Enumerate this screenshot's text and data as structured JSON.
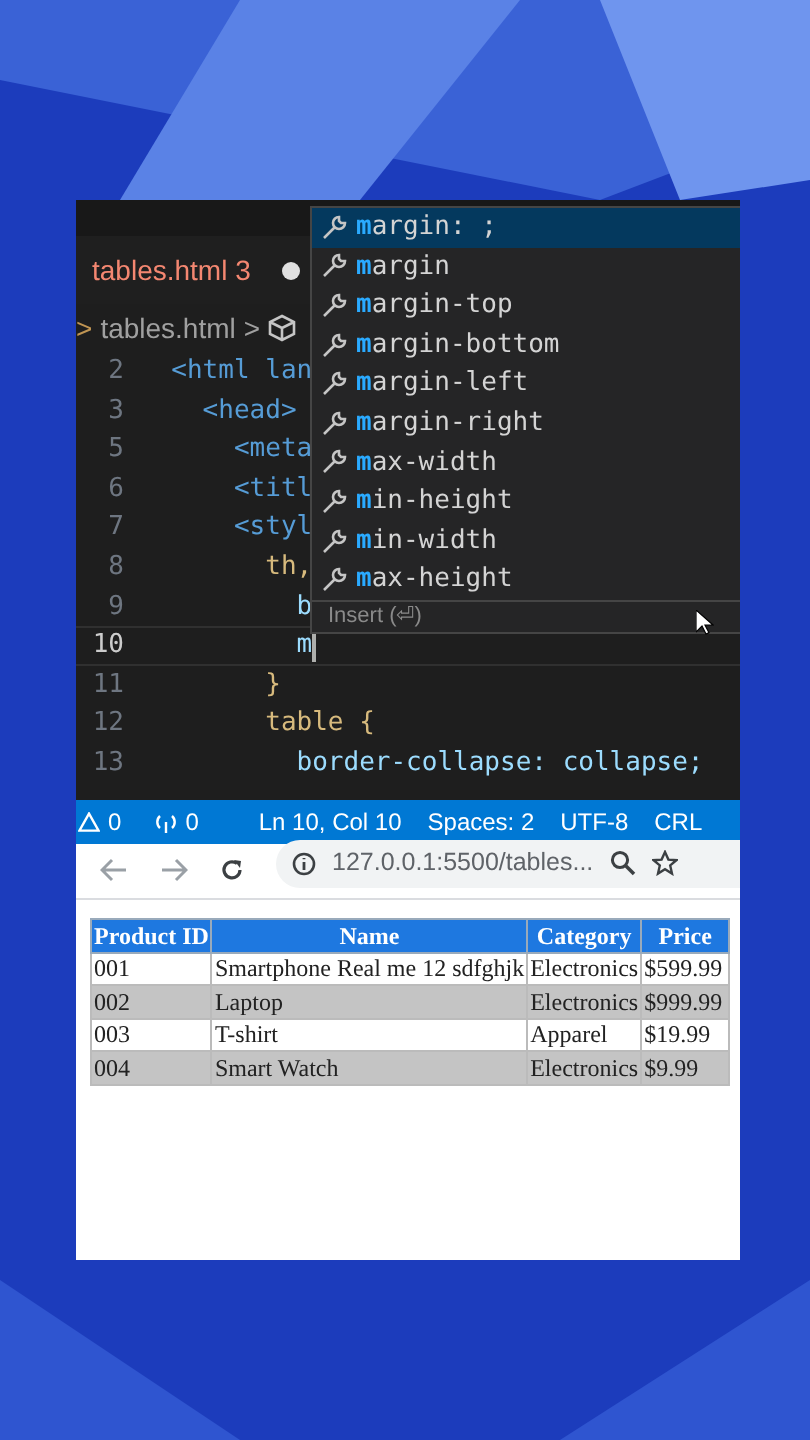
{
  "editor": {
    "tab": {
      "label": "tables.html",
      "problems": "3",
      "modified": true
    },
    "breadcrumb": {
      "separator_before": ">",
      "file": "tables.html",
      "separator_after": ">"
    },
    "lines": [
      {
        "number": "2",
        "text": "  <html lan",
        "current": false
      },
      {
        "number": "3",
        "text": "    <head>",
        "current": false
      },
      {
        "number": "5",
        "text": "      <meta",
        "current": false
      },
      {
        "number": "6",
        "text": "      <titl",
        "current": false
      },
      {
        "number": "7",
        "text": "      <styl",
        "current": false
      },
      {
        "number": "8",
        "text": "        th,",
        "current": false
      },
      {
        "number": "9",
        "text": "          b",
        "current": false
      },
      {
        "number": "10",
        "text": "          m",
        "current": true
      },
      {
        "number": "11",
        "text": "        }",
        "current": false
      },
      {
        "number": "12",
        "text": "        table {",
        "current": false
      },
      {
        "number": "13",
        "text": "          border-collapse: collapse;",
        "current": false
      }
    ],
    "suggestions": [
      {
        "label": "margin: ;",
        "selected": true
      },
      {
        "label": "margin",
        "selected": false
      },
      {
        "label": "margin-top",
        "selected": false
      },
      {
        "label": "margin-bottom",
        "selected": false
      },
      {
        "label": "margin-left",
        "selected": false
      },
      {
        "label": "margin-right",
        "selected": false
      },
      {
        "label": "max-width",
        "selected": false
      },
      {
        "label": "min-height",
        "selected": false
      },
      {
        "label": "min-width",
        "selected": false
      },
      {
        "label": "max-height",
        "selected": false
      }
    ],
    "suggest_footer": "Insert (⏎)"
  },
  "status_bar": {
    "warnings": "0",
    "ports": "0",
    "items": [
      "Ln 10, Col 10",
      "Spaces: 2",
      "UTF-8",
      "CRL"
    ]
  },
  "browser": {
    "url": "127.0.0.1:5500/tables...",
    "table": {
      "columns": [
        "Product ID",
        "Name",
        "Category",
        "Price"
      ],
      "rows": [
        [
          "001",
          "Smartphone Real me 12 sdfghjk",
          "Electronics",
          "$599.99"
        ],
        [
          "002",
          "Laptop",
          "Electronics",
          "$999.99"
        ],
        [
          "003",
          "T-shirt",
          "Apparel",
          "$19.99"
        ],
        [
          "004",
          "Smart Watch",
          "Electronics",
          "$9.99"
        ]
      ]
    }
  }
}
